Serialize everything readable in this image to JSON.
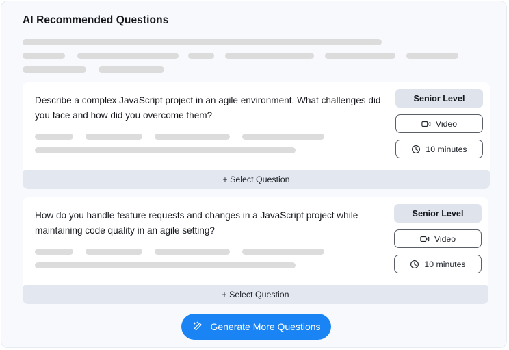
{
  "panel": {
    "title": "AI Recommended Questions"
  },
  "intro_skeleton": {
    "rows": [
      [
        525
      ],
      [
        62,
        18,
        148,
        14,
        38,
        16,
        130,
        16,
        103,
        16,
        76
      ],
      [
        93,
        18,
        96
      ]
    ]
  },
  "questions": [
    {
      "text": "Describe a complex JavaScript project in an agile environment. What challenges did you face and how did you overcome them?",
      "level_badge": "Senior Level",
      "format_label": "Video",
      "format_icon": "video-camera-icon",
      "duration_label": "10 minutes",
      "duration_icon": "clock-icon",
      "select_label": "+ Select Question",
      "skeleton_rows": [
        [
          56,
          18,
          83,
          18,
          110,
          18,
          120
        ],
        [
          381
        ]
      ]
    },
    {
      "text": "How do you handle feature requests and changes in a JavaScript project while maintaining code quality in an agile setting?",
      "level_badge": "Senior Level",
      "format_label": "Video",
      "format_icon": "video-camera-icon",
      "duration_label": "10 minutes",
      "duration_icon": "clock-icon",
      "select_label": "+ Select Question",
      "skeleton_rows": [
        [
          56,
          18,
          83,
          18,
          110,
          18,
          120
        ],
        [
          381
        ]
      ]
    }
  ],
  "generate": {
    "label": "Generate More Questions",
    "icon": "magic-wand-icon",
    "color": "#1a84f5"
  },
  "colors": {
    "page_background": "#f7f9fd",
    "card_background": "#ffffff",
    "skeleton": "#dcdcdc",
    "badge": "#dfe4ec",
    "select_bar": "#e3e8f0",
    "accent": "#1a84f5",
    "text": "#16181d"
  }
}
